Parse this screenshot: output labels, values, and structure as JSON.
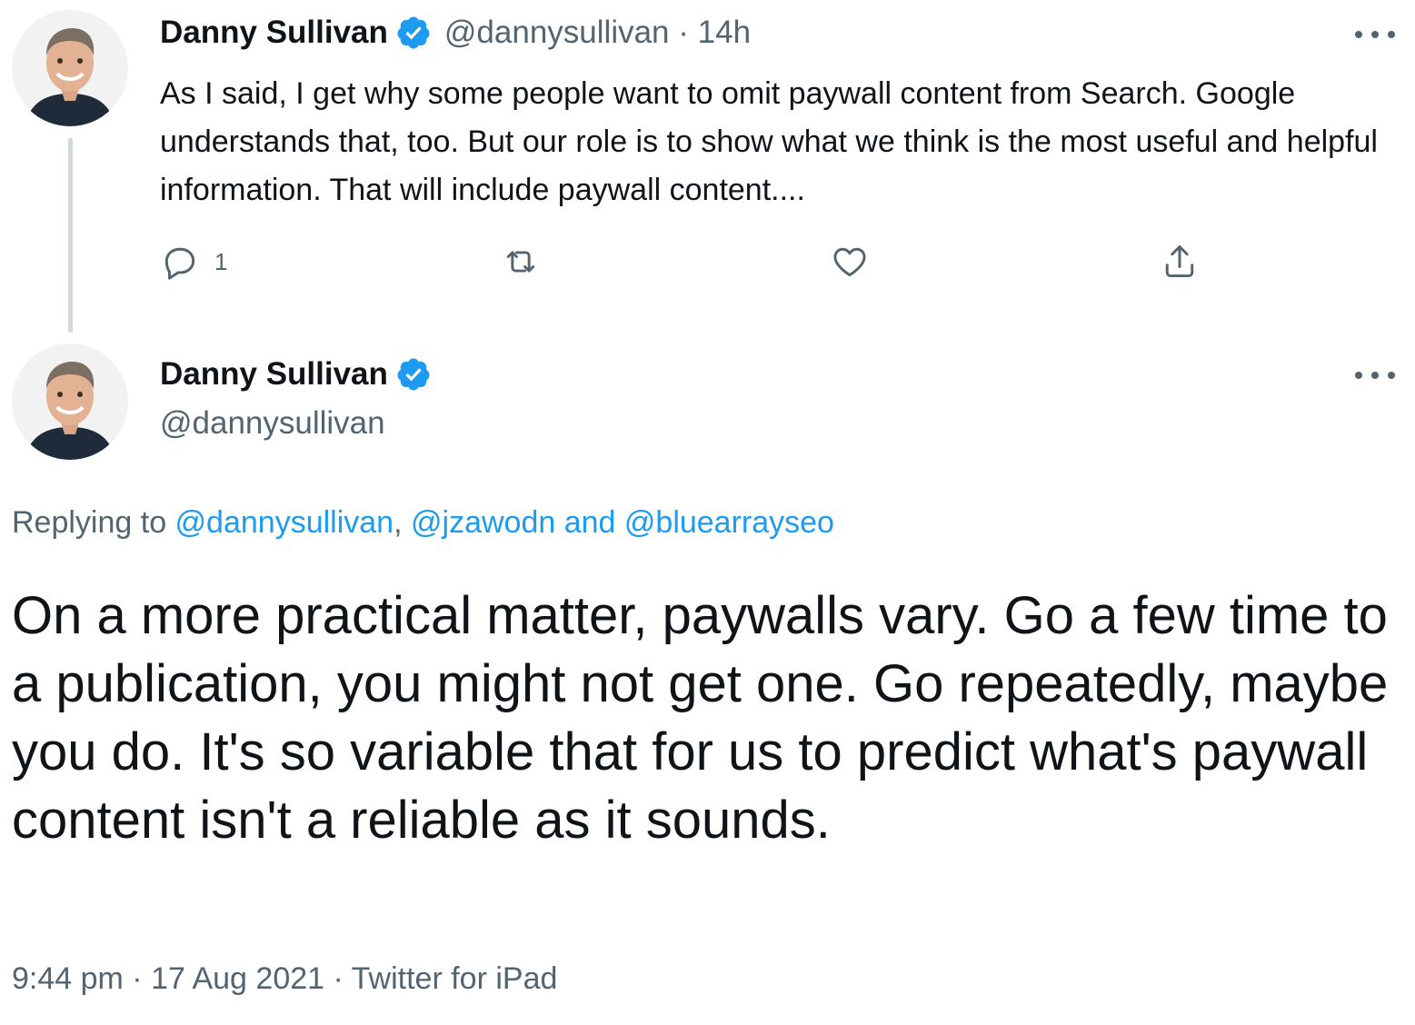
{
  "thread_tweet": {
    "author_name": "Danny Sullivan",
    "handle": "@dannysullivan",
    "separator": "·",
    "time_ago": "14h",
    "text": "As I said, I get why some people want to omit paywall content from Search. Google understands that, too. But our role is to show what we think is the most useful and helpful information. That will include paywall content....",
    "actions": {
      "reply_icon": "reply-icon",
      "reply_count": "1",
      "retweet_icon": "retweet-icon",
      "like_icon": "heart-icon",
      "share_icon": "share-icon"
    }
  },
  "main_tweet": {
    "author_name": "Danny Sullivan",
    "handle": "@dannysullivan",
    "replying_prefix": "Replying to ",
    "replying_user_1": "@dannysullivan",
    "replying_sep": ", ",
    "replying_user_2": "@jzawodn",
    "replying_and": " and ",
    "replying_user_3": "@bluearrayseo",
    "text": "On a more practical matter, paywalls vary. Go a few time to a publication, you might not get one. Go repeatedly, maybe you do. It's so variable that for us to predict what's paywall content isn't a reliable as it sounds.",
    "time": "9:44 pm",
    "meta_sep_1": " · ",
    "date": "17 Aug 2021",
    "meta_sep_2": " · ",
    "source": "Twitter for iPad"
  },
  "colors": {
    "text_primary": "#0f1419",
    "text_secondary": "#536471",
    "link": "#1d9bf0",
    "verified": "#1d9bf0",
    "thread_line": "#cfd9de"
  }
}
